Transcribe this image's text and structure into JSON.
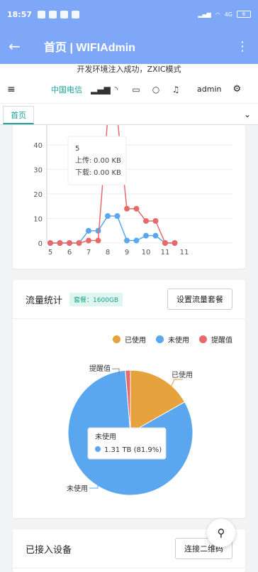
{
  "status_bar": {
    "time": "18:57",
    "right_text": "4G",
    "battery": "6"
  },
  "app_bar": {
    "title": "首页 | WIFIAdmin"
  },
  "notice": "开发环境注入成功，ZXIC模式",
  "toolbar": {
    "carrier": "中国电信",
    "user": "admin"
  },
  "tabs": [
    {
      "label": "首页"
    }
  ],
  "colors": {
    "primary": "#7fa7f8",
    "teal": "#1aa39a",
    "used": "#e6a23c",
    "unused": "#5aa7f0",
    "alert": "#e66a6a"
  },
  "line_chart": {
    "chart_data": {
      "type": "line",
      "x_ticks": [
        "5",
        "6",
        "7",
        "8",
        "9",
        "10",
        "11",
        "11"
      ],
      "y_ticks": [
        "0",
        "10",
        "20",
        "30",
        "40"
      ],
      "ylim": [
        0,
        45
      ],
      "series": [
        {
          "name": "上传",
          "color": "#5aa7f0",
          "x": [
            5,
            5.5,
            6,
            6.5,
            7,
            7.5,
            8,
            8.5,
            9,
            9.5,
            10,
            10.5,
            11,
            11.5
          ],
          "y": [
            0,
            0,
            0,
            0,
            5,
            5,
            11,
            11,
            1,
            1,
            3,
            3,
            0,
            0
          ]
        },
        {
          "name": "下载",
          "color": "#e66a6a",
          "x": [
            5,
            5.5,
            6,
            6.5,
            7,
            7.5,
            8,
            8.5,
            9,
            9.5,
            10,
            10.5,
            11,
            11.5
          ],
          "y": [
            0,
            0,
            0,
            0,
            1,
            1,
            60,
            60,
            14,
            14,
            9,
            9,
            0,
            0
          ]
        }
      ]
    },
    "tooltip": {
      "title": "5",
      "upload_label": "上传:",
      "upload_value": "0.00 KB",
      "download_label": "下载:",
      "download_value": "0.00 KB"
    }
  },
  "traffic": {
    "title": "流量统计",
    "package_badge": "套餐：1600GB",
    "set_button": "设置流量套餐",
    "legend": [
      {
        "label": "已使用",
        "color": "#e6a23c"
      },
      {
        "label": "未使用",
        "color": "#5aa7f0"
      },
      {
        "label": "提醒值",
        "color": "#e66a6a"
      }
    ],
    "chart_data": {
      "type": "pie",
      "slices": [
        {
          "name": "已使用",
          "value": 16.8,
          "color": "#e6a23c"
        },
        {
          "name": "未使用",
          "value": 81.9,
          "color": "#5aa7f0"
        },
        {
          "name": "提醒值",
          "value": 1.3,
          "color": "#e66a6a"
        }
      ],
      "labels": {
        "used": "已使用",
        "unused": "未使用",
        "alert": "提醒值"
      }
    },
    "tooltip": {
      "title": "未使用",
      "value": "1.31 TB (81.9%)"
    }
  },
  "devices": {
    "title": "已接入设备",
    "qr_button": "连接二维码"
  }
}
